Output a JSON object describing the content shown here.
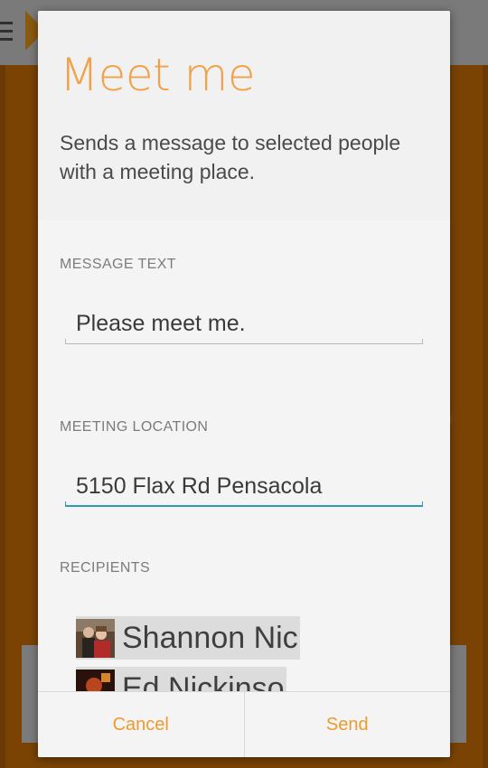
{
  "dialog": {
    "title": "Meet me",
    "description": "Sends a message to selected people with a meeting place.",
    "message_section": {
      "label": "MESSAGE TEXT",
      "value": "Please meet me."
    },
    "location_section": {
      "label": "MEETING LOCATION",
      "value": "5150 Flax Rd Pensacola"
    },
    "recipients_section": {
      "label": "RECIPIENTS",
      "recipients": [
        {
          "name": "Shannon Nic"
        },
        {
          "name": "Ed Nickinso"
        }
      ]
    },
    "buttons": {
      "cancel": "Cancel",
      "send": "Send"
    }
  },
  "colors": {
    "accent": "#f0a14a",
    "focus": "#2f9bb3",
    "background_app": "#7a4304"
  },
  "icons": {
    "menu": "menu-icon",
    "logo": "app-logo-icon"
  }
}
